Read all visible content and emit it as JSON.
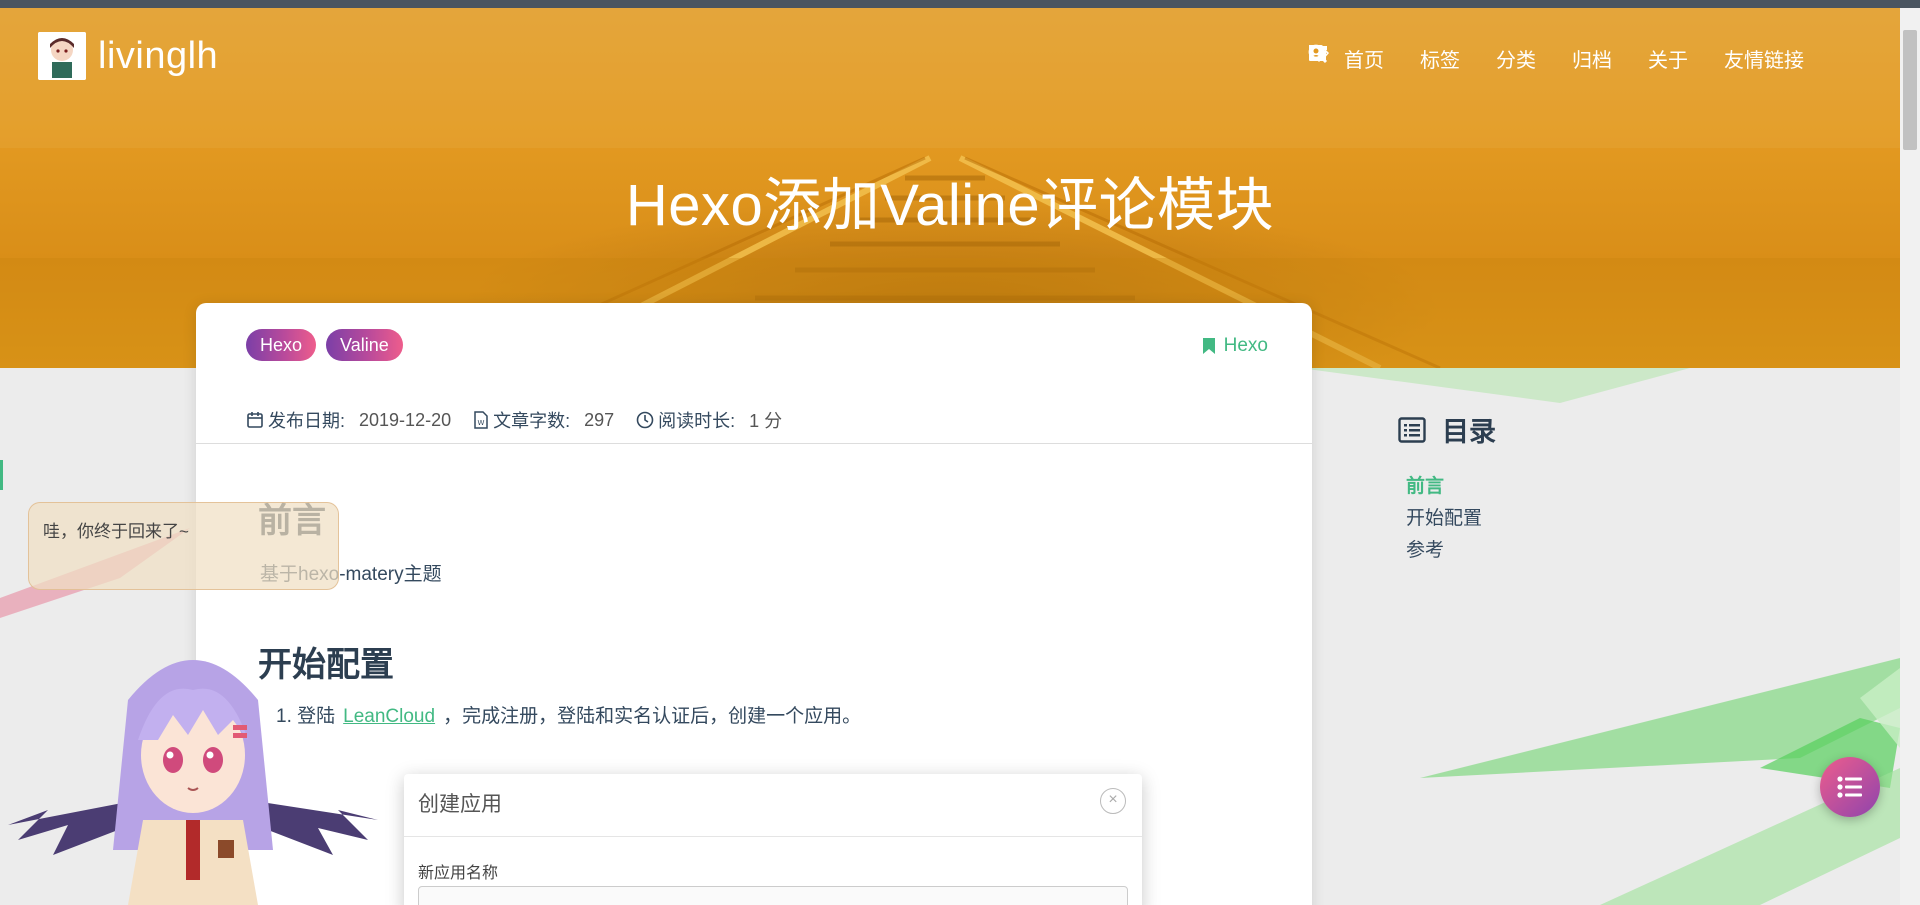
{
  "site": {
    "name": "livinglh",
    "avatar": "avatar-icon"
  },
  "nav": {
    "items": [
      {
        "label": "首页",
        "icon": "home-icon"
      },
      {
        "label": "标签",
        "icon": "tags-icon"
      },
      {
        "label": "分类",
        "icon": "bookmark-icon"
      },
      {
        "label": "归档",
        "icon": "archive-icon"
      },
      {
        "label": "关于",
        "icon": "user-circle-icon"
      },
      {
        "label": "友情链接",
        "icon": "address-book-icon"
      }
    ],
    "search_icon": "search-icon"
  },
  "post": {
    "title": "Hexo添加Valine评论模块",
    "tags": [
      "Hexo",
      "Valine"
    ],
    "category": "Hexo",
    "meta": {
      "date_label": "发布日期:",
      "date": "2019-12-20",
      "words_label": "文章字数:",
      "words": "297",
      "read_label": "阅读时长:",
      "read": "1 分"
    },
    "intro_heading": "前言",
    "intro_text": "基于hexo-matery主题",
    "start_heading": "开始配置",
    "step1": {
      "number": "1.",
      "before": "登陆",
      "link": "LeanCloud",
      "after": "，完成注册，登陆和实名认证后，创建一个应用。"
    },
    "screenshot_dialog": {
      "title": "创建应用",
      "close": "×",
      "field_label": "新应用名称"
    }
  },
  "toc": {
    "title": "目录",
    "items": [
      "前言",
      "开始配置",
      "参考"
    ],
    "active_index": 0
  },
  "widget": {
    "bubble_text": "哇，你终于回来了~"
  },
  "colors": {
    "accent": "#42b983",
    "banner": "#e39a22",
    "tag_gradient_start": "#7b3fa7",
    "tag_gradient_end": "#ee5d8c"
  }
}
